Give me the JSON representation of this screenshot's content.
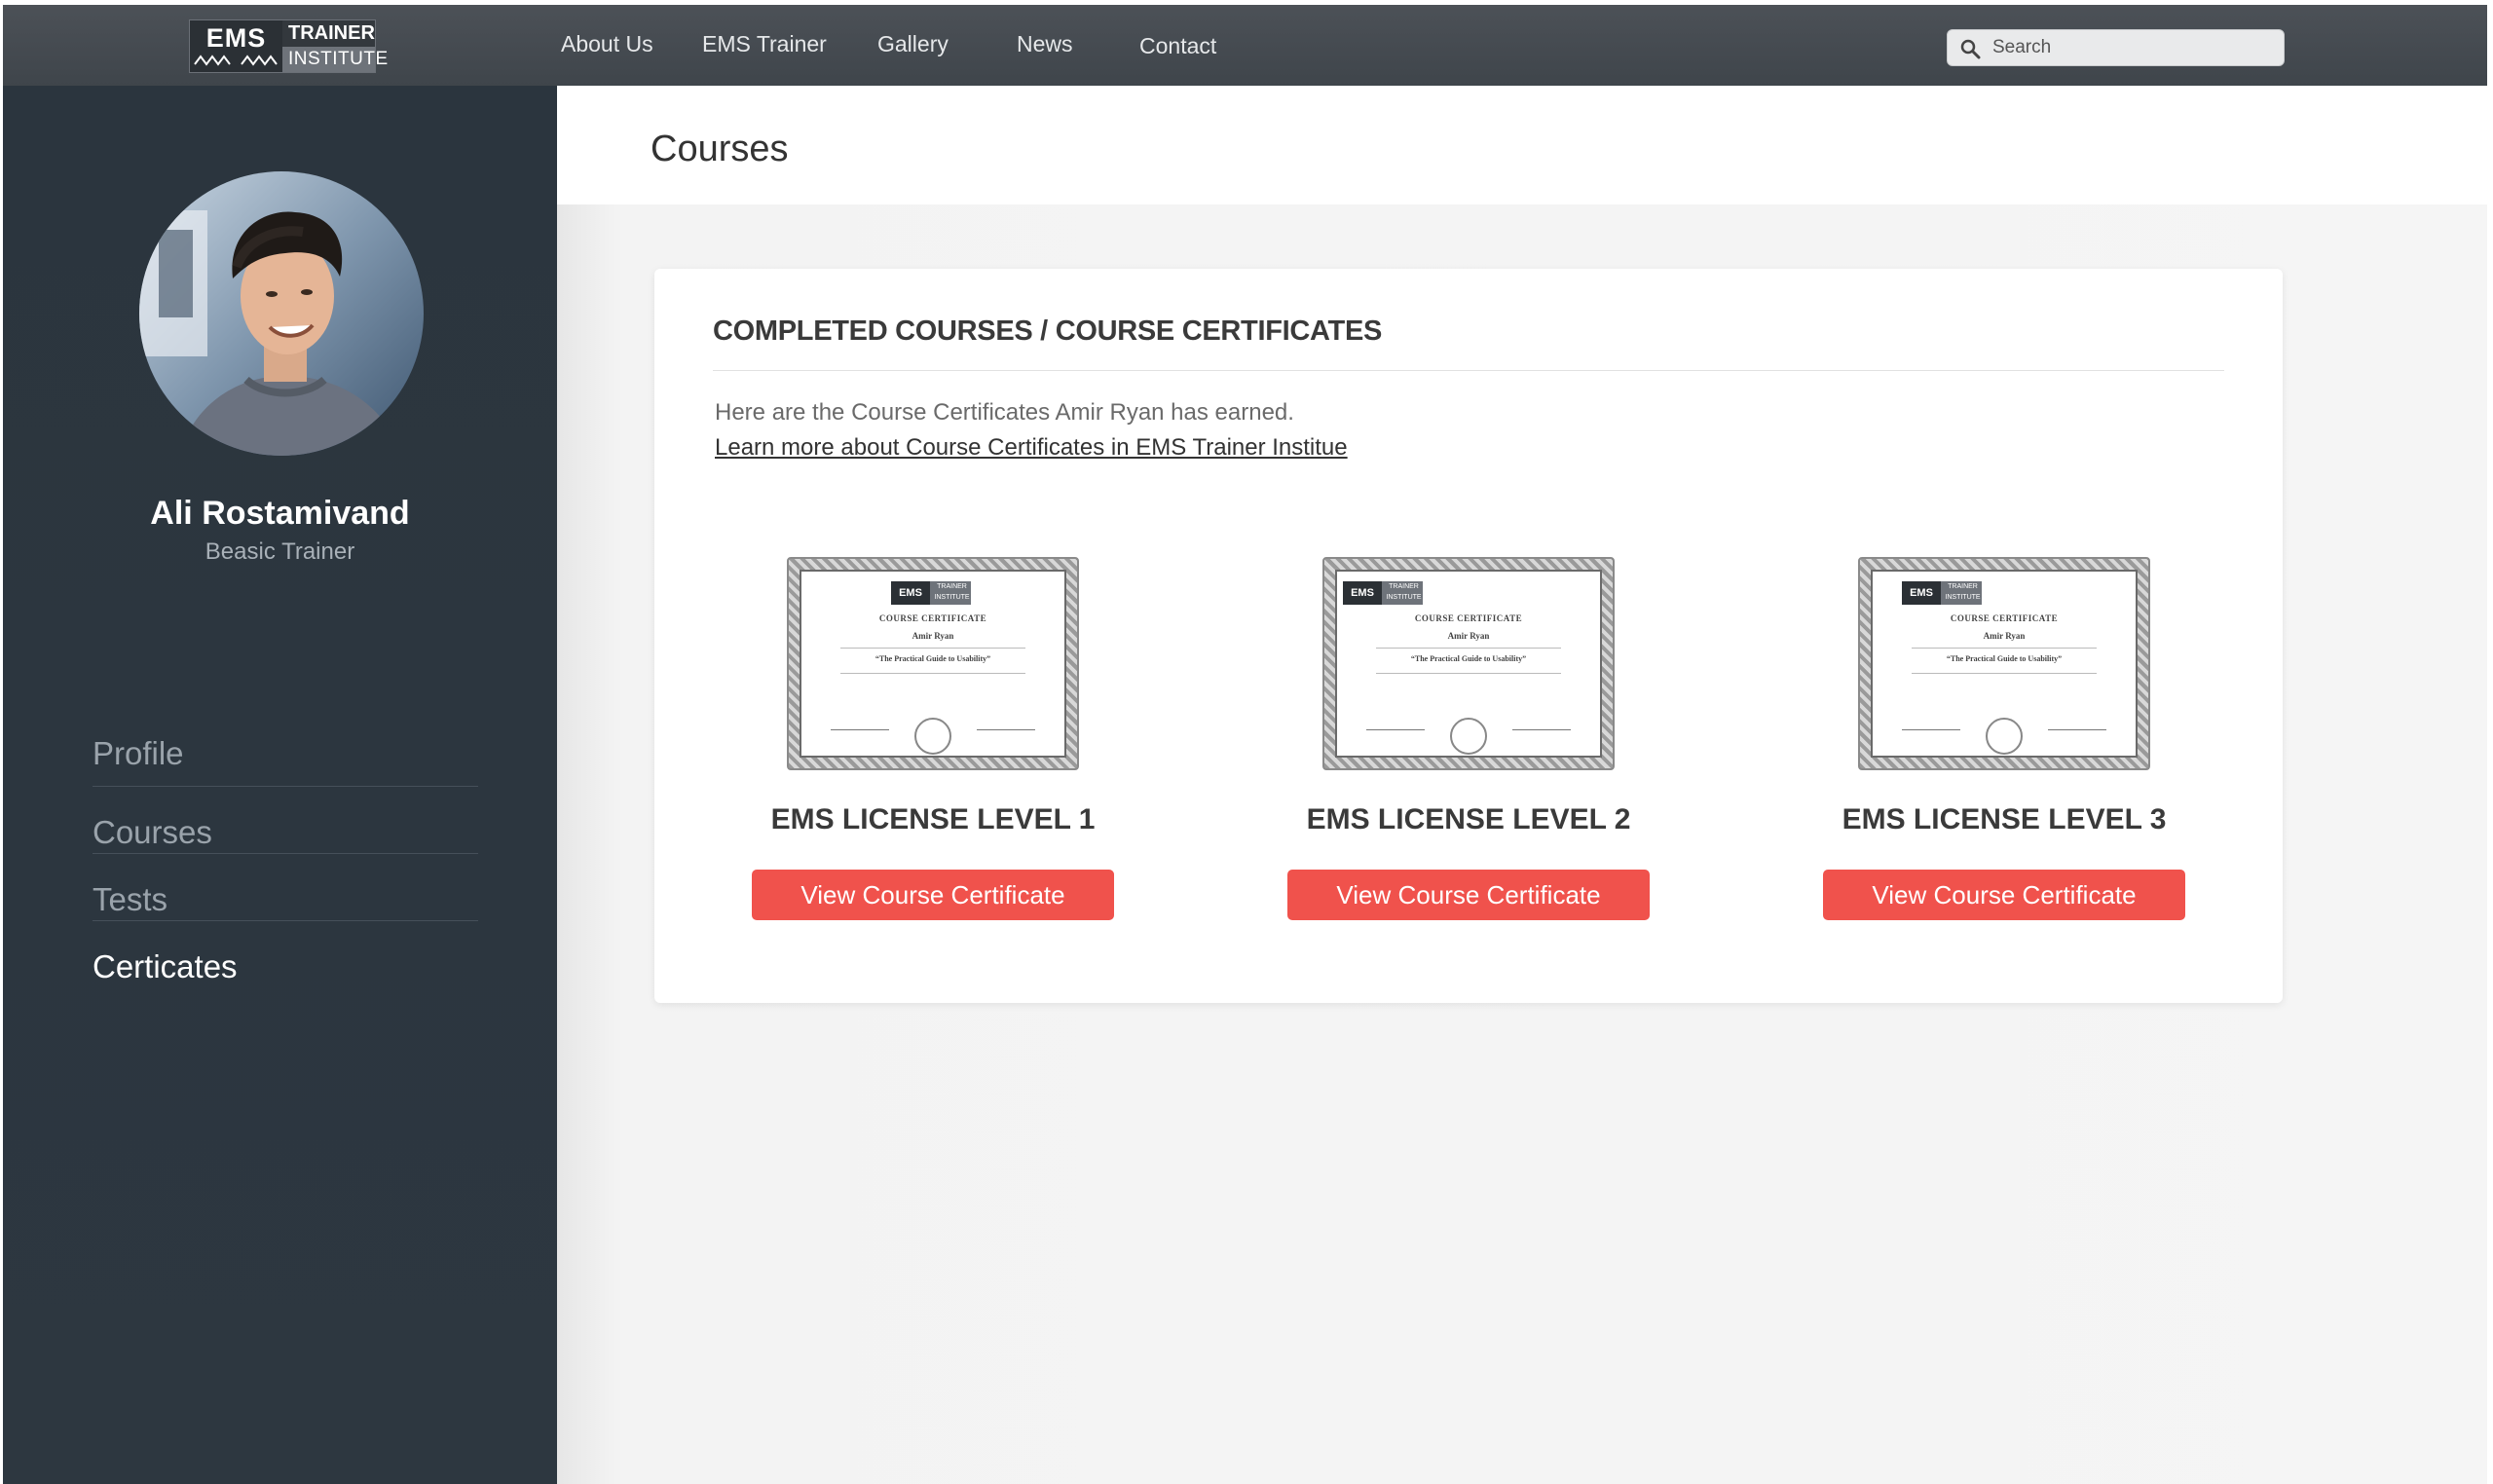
{
  "header": {
    "logo": {
      "text_primary": "EMS",
      "text_secondary_top": "TRAINER",
      "text_secondary_bottom": "INSTITUTE"
    },
    "nav": [
      {
        "label": "About Us"
      },
      {
        "label": "EMS Trainer"
      },
      {
        "label": "Gallery"
      },
      {
        "label": "News"
      },
      {
        "label": "Contact"
      }
    ],
    "search": {
      "placeholder": "Search",
      "value": ""
    }
  },
  "sidebar": {
    "user": {
      "name": "Ali Rostamivand",
      "role": "Beasic Trainer"
    },
    "menu": [
      {
        "label": "Profile"
      },
      {
        "label": "Courses"
      },
      {
        "label": "Tests"
      },
      {
        "label": "Certicates",
        "active": true
      }
    ]
  },
  "main": {
    "page_title": "Courses",
    "card": {
      "title": "COMPLETED COURSES / COURSE CERTIFICATES",
      "description": "Here are the Course Certificates Amir Ryan has earned.",
      "link": "Learn more about Course Certificates in EMS Trainer Institue",
      "certificates": [
        {
          "label": "EMS LICENSE LEVEL 1",
          "button": "View Course Certificate",
          "thumb": {
            "heading": "COURSE CERTIFICATE",
            "recipient": "Amir Ryan",
            "course": "“The Practical Guide to Usability”"
          }
        },
        {
          "label": "EMS LICENSE LEVEL 2",
          "button": "View Course Certificate",
          "thumb": {
            "heading": "COURSE CERTIFICATE",
            "recipient": "Amir Ryan",
            "course": "“The Practical Guide to Usability”"
          }
        },
        {
          "label": "EMS LICENSE LEVEL 3",
          "button": "View Course Certificate",
          "thumb": {
            "heading": "COURSE CERTIFICATE",
            "recipient": "Amir Ryan",
            "course": "“The Practical Guide to Usability”"
          }
        }
      ]
    }
  },
  "colors": {
    "topbar": "#474c52",
    "sidebar": "#2c363f",
    "accent_button": "#f0524c",
    "content_bg": "#f4f4f4"
  },
  "icons": {
    "search": "search-icon"
  }
}
